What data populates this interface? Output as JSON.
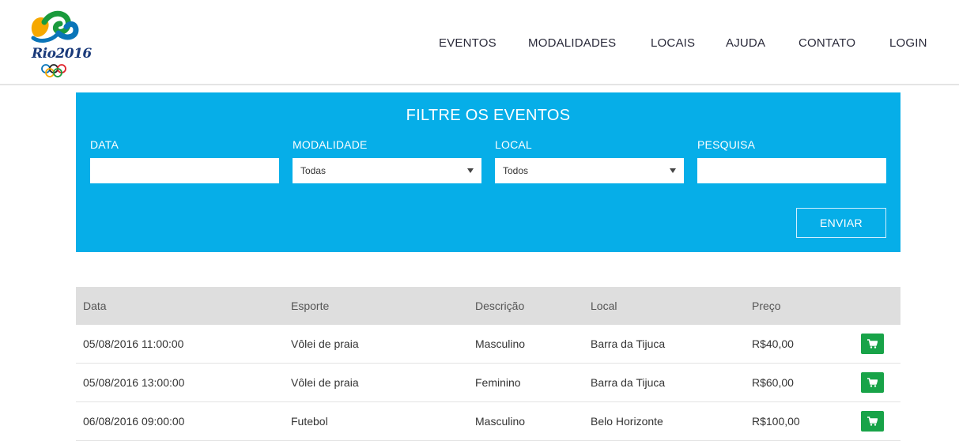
{
  "header": {
    "logo_text": "Rio2016",
    "nav": [
      {
        "label": "EVENTOS"
      },
      {
        "label": "MODALIDADES"
      },
      {
        "label": "LOCAIS"
      },
      {
        "label": "AJUDA"
      },
      {
        "label": "CONTATO"
      },
      {
        "label": "LOGIN"
      }
    ]
  },
  "filter": {
    "title": "FILTRE OS EVENTOS",
    "data_label": "DATA",
    "data_value": "",
    "modalidade_label": "MODALIDADE",
    "modalidade_selected": "Todas",
    "local_label": "LOCAL",
    "local_selected": "Todos",
    "pesquisa_label": "PESQUISA",
    "pesquisa_value": "",
    "submit_label": "ENVIAR",
    "panel_color": "#06aee8"
  },
  "table": {
    "headers": {
      "data": "Data",
      "esporte": "Esporte",
      "descricao": "Descrição",
      "local": "Local",
      "preco": "Preço"
    },
    "rows": [
      {
        "data": "05/08/2016 11:00:00",
        "esporte": "Vôlei de praia",
        "descricao": "Masculino",
        "local": "Barra da Tijuca",
        "preco": "R$40,00",
        "action_icon": "cart-icon"
      },
      {
        "data": "05/08/2016 13:00:00",
        "esporte": "Vôlei de praia",
        "descricao": "Feminino",
        "local": "Barra da Tijuca",
        "preco": "R$60,00",
        "action_icon": "cart-icon"
      },
      {
        "data": "06/08/2016 09:00:00",
        "esporte": "Futebol",
        "descricao": "Masculino",
        "local": "Belo Horizonte",
        "preco": "R$100,00",
        "action_icon": "cart-icon"
      }
    ],
    "cart_color": "#18a348"
  }
}
